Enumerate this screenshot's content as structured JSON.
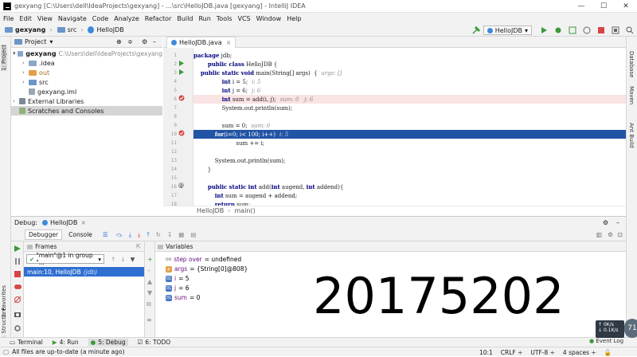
{
  "window": {
    "title": "gexyang [C:\\Users\\dell\\IdeaProjects\\gexyang] - ...\\src\\HelloJDB.java [gexyang] - IntelliJ IDEA",
    "controls": [
      "—",
      "☐",
      "✕"
    ]
  },
  "menu": [
    "File",
    "Edit",
    "View",
    "Navigate",
    "Code",
    "Analyze",
    "Refactor",
    "Build",
    "Run",
    "Tools",
    "VCS",
    "Window",
    "Help"
  ],
  "navbar": {
    "crumbs": [
      "gexyang",
      "src",
      "HelloJDB"
    ],
    "run_config": "HelloJDB"
  },
  "left_stripe": {
    "project_tab": "1: Project",
    "favorites_tab": "2: Favorites",
    "structure_tab": "Z: Structure"
  },
  "right_stripe": {
    "database_tab": "Database",
    "maven_tab": "Maven",
    "ant_tab": "Ant Build"
  },
  "project": {
    "header": "Project",
    "tree": [
      {
        "label": "gexyang",
        "path": "C:\\Users\\dell\\IdeaProjects\\gexyang",
        "indent": 0,
        "arrow": "▾",
        "icon": "folder-icon"
      },
      {
        "label": ".idea",
        "path": "",
        "indent": 1,
        "arrow": "›",
        "icon": "folder-icon"
      },
      {
        "label": "out",
        "path": "",
        "indent": 1,
        "arrow": "›",
        "icon": "folder-icon"
      },
      {
        "label": "src",
        "path": "",
        "indent": 1,
        "arrow": "›",
        "icon": "folder-icon"
      },
      {
        "label": "gexyang.iml",
        "path": "",
        "indent": 1,
        "arrow": "",
        "icon": "file-icon"
      },
      {
        "label": "External Libraries",
        "path": "",
        "indent": 0,
        "arrow": "›",
        "icon": "library-icon"
      },
      {
        "label": "Scratches and Consoles",
        "path": "",
        "indent": 0,
        "arrow": "",
        "icon": "scratch-icon"
      }
    ]
  },
  "editor": {
    "tab": "HelloJDB.java",
    "breadcrumb": [
      "HelloJDB",
      "main()"
    ],
    "lines": [
      {
        "n": "1",
        "code": "package jdb;",
        "hint": "",
        "style": ""
      },
      {
        "n": "2",
        "code": "        public class HelloJDB {",
        "hint": "",
        "style": ""
      },
      {
        "n": "3",
        "code": "    public static void main(String[] args)  {",
        "hint": "args: []",
        "style": ""
      },
      {
        "n": "4",
        "code": "                int i = 5;",
        "hint": "i: 5",
        "style": ""
      },
      {
        "n": "5",
        "code": "                int j = 6;",
        "hint": "j: 6",
        "style": ""
      },
      {
        "n": "6",
        "code": "                int sum = add(i, j);",
        "hint": "sum: 0   j: 6",
        "style": "bp"
      },
      {
        "n": "7",
        "code": "                System.out.println(sum);",
        "hint": "",
        "style": ""
      },
      {
        "n": "8",
        "code": "",
        "hint": "",
        "style": ""
      },
      {
        "n": "9",
        "code": "                sum = 0;",
        "hint": "sum: 0",
        "style": ""
      },
      {
        "n": "10",
        "code": "            for(i=0; i< 100; i++)",
        "hint": "i: 5",
        "style": "exec"
      },
      {
        "n": "11",
        "code": "                        sum += i;",
        "hint": "",
        "style": ""
      },
      {
        "n": "12",
        "code": "",
        "hint": "",
        "style": ""
      },
      {
        "n": "13",
        "code": "            System.out.println(sum);",
        "hint": "",
        "style": ""
      },
      {
        "n": "14",
        "code": "        }",
        "hint": "",
        "style": ""
      },
      {
        "n": "15",
        "code": "",
        "hint": "",
        "style": ""
      },
      {
        "n": "16",
        "code": "        public static int add(int augend, int addend){",
        "hint": "",
        "style": ""
      },
      {
        "n": "17",
        "code": "            int sum = augend + addend;",
        "hint": "",
        "style": ""
      },
      {
        "n": "18",
        "code": "            return sum;",
        "hint": "",
        "style": ""
      }
    ]
  },
  "debug": {
    "label": "Debug:",
    "session": "HelloJDB",
    "tabs": [
      "Debugger",
      "Console"
    ],
    "frames_header": "Frames",
    "thread": "\"main\"@1 in group \"...",
    "frame": "main:10, HelloJDB",
    "frame_pkg": "(jdb)",
    "variables_header": "Variables",
    "variables": [
      {
        "badge": "oo",
        "name": "step over",
        "value": "= undefined",
        "kind": "o"
      },
      {
        "badge": "p",
        "name": "args",
        "value": "= {String[0]@808}",
        "kind": "p"
      },
      {
        "badge": "01",
        "name": "i",
        "value": "= 5",
        "kind": "v"
      },
      {
        "badge": "01",
        "name": "j",
        "value": "= 6",
        "kind": "v"
      },
      {
        "badge": "01",
        "name": "sum",
        "value": "= 0",
        "kind": "v"
      }
    ]
  },
  "overlay_number": "20175202",
  "bottom_tabs": [
    "Terminal",
    "4: Run",
    "5: Debug",
    "6: TODO"
  ],
  "event_log": "Event Log",
  "status": {
    "message": "All files are up-to-date (a minute ago)",
    "position": "10:1",
    "line_sep": "CRLF ÷",
    "encoding": "UTF-8 ÷",
    "indent": "4 spaces ÷"
  },
  "net_widget": {
    "up": "0K/s",
    "down": "0.1K/s",
    "percent": "71"
  }
}
